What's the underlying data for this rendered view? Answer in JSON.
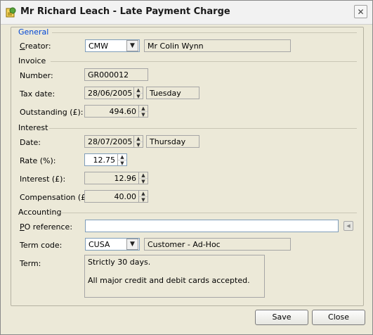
{
  "window": {
    "title": "Mr Richard Leach - Late Payment Charge"
  },
  "general": {
    "section_label": "General",
    "creator_label_u": "C",
    "creator_label_rest": "reator:",
    "creator_code": "CMW",
    "creator_name": "Mr Colin Wynn"
  },
  "invoice": {
    "section_label": "Invoice",
    "number_label": "Number:",
    "number_value": "GR000012",
    "taxdate_label": "Tax date:",
    "taxdate_value": "28/06/2005",
    "taxdate_day": "Tuesday",
    "outstanding_label": "Outstanding (£):",
    "outstanding_value": "494.60"
  },
  "interest": {
    "section_label": "Interest",
    "date_label": "Date:",
    "date_value": "28/07/2005",
    "date_day": "Thursday",
    "rate_label": "Rate (%):",
    "rate_value": "12.75",
    "interest_label": "Interest (£):",
    "interest_value": "12.96",
    "compensation_label": "Compensation (£):",
    "compensation_value": "40.00"
  },
  "accounting": {
    "section_label": "Accounting",
    "po_label_u": "P",
    "po_label_rest": "O reference:",
    "po_value": "",
    "termcode_label": "Term code:",
    "termcode_value": "CUSA",
    "termcode_desc": "Customer - Ad-Hoc",
    "term_label": "Term:",
    "term_line1": "Strictly 30 days.",
    "term_line2": "All major credit and debit cards accepted."
  },
  "buttons": {
    "save": "Save",
    "close": "Close"
  },
  "colors": {
    "section_accent": "#0046d5"
  }
}
